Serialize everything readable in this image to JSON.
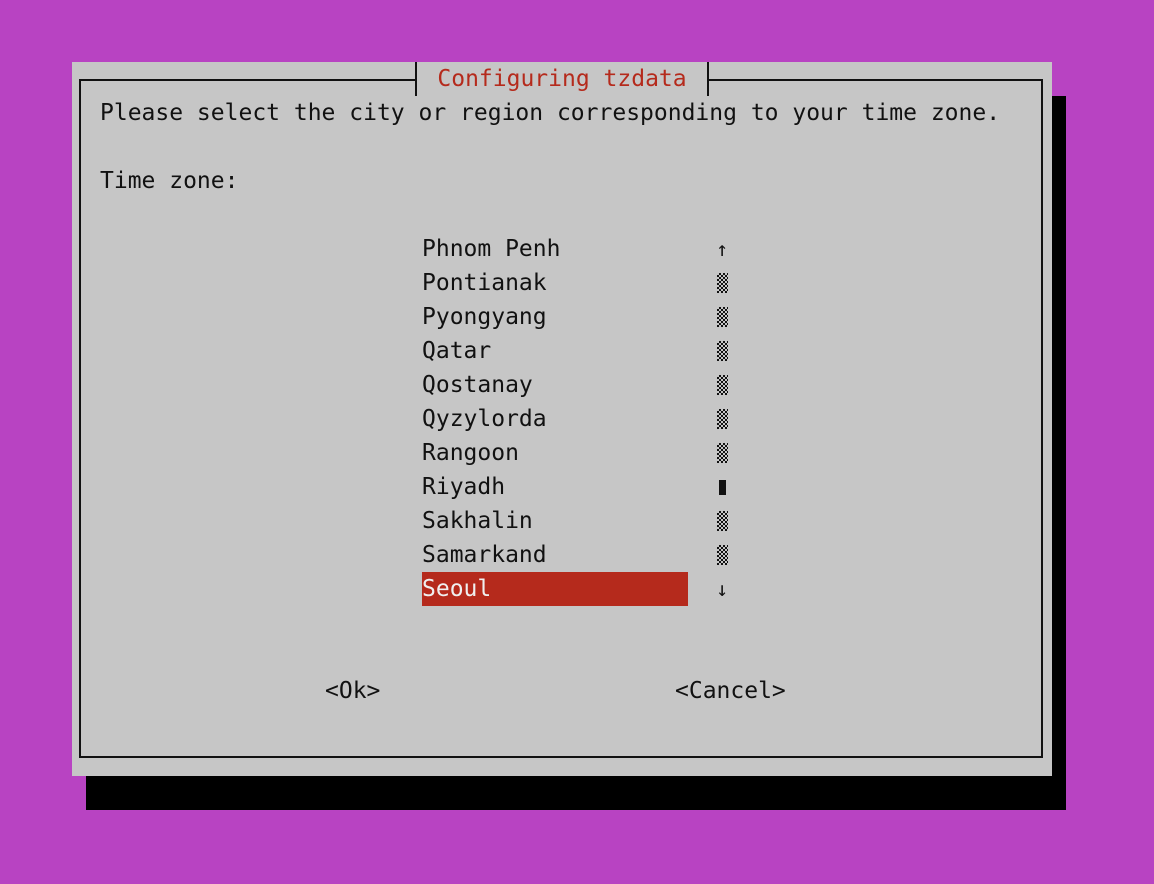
{
  "dialog": {
    "title": "Configuring tzdata",
    "prompt": "Please select the city or region corresponding to your time zone.",
    "field_label": "Time zone:",
    "ok_label": "<Ok>",
    "cancel_label": "<Cancel>"
  },
  "timezones": {
    "items": [
      "Phnom Penh",
      "Pontianak",
      "Pyongyang",
      "Qatar",
      "Qostanay",
      "Qyzylorda",
      "Rangoon",
      "Riyadh",
      "Sakhalin",
      "Samarkand",
      "Seoul"
    ],
    "selected": "Seoul"
  },
  "scrollbar": {
    "up_arrow": "↑",
    "down_arrow": "↓"
  },
  "colors": {
    "desktop_bg": "#b843c2",
    "dialog_bg": "#c6c6c6",
    "accent": "#b52a1c",
    "shadow": "#000000"
  }
}
